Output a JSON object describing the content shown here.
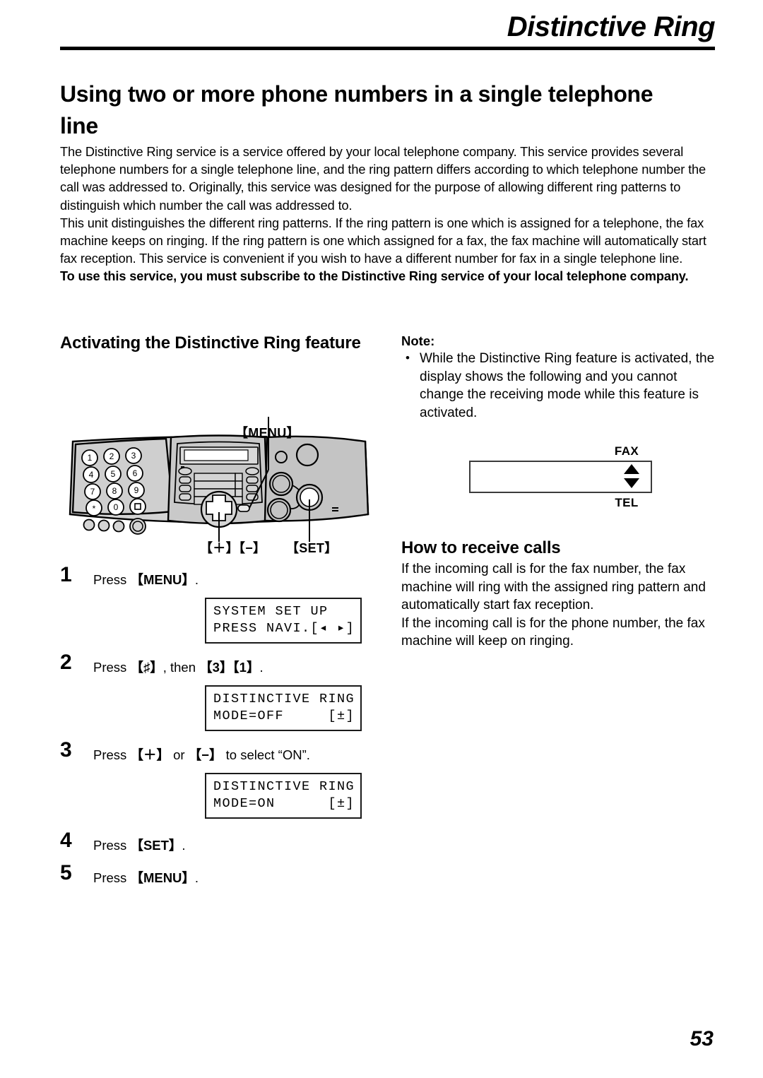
{
  "header": {
    "chapter_title": "Distinctive Ring"
  },
  "page_title": "Using two or more phone numbers in a single telephone line",
  "intro": {
    "paragraph1": "The Distinctive Ring service is a service offered by your local telephone company. This service provides several telephone numbers for a single telephone line, and the ring pattern differs according to which telephone number the call was addressed to. Originally, this service was designed for the purpose of allowing different ring patterns to distinguish which number the call was addressed to.",
    "paragraph2": "This unit distinguishes the different ring patterns. If the ring pattern is one which is assigned for a telephone, the fax machine keeps on ringing. If the ring pattern is one which assigned for a fax, the fax machine will automatically start fax reception. This service is convenient if you wish to have a different number for fax in a single telephone line.",
    "paragraph3_bold": "To use this service, you must subscribe to the Distinctive Ring service of your local telephone company."
  },
  "left_column": {
    "section_heading": "Activating the Distinctive Ring feature",
    "figure": {
      "callout_menu": "【MENU】",
      "callout_plusminus": "【＋】【−】",
      "callout_set": "【SET】",
      "keypad_keys": [
        "1",
        "2",
        "3",
        "4",
        "5",
        "6",
        "7",
        "8",
        "9",
        "∗",
        "0",
        "□"
      ]
    },
    "steps": [
      {
        "number": "1",
        "text_parts": [
          {
            "t": "Press ",
            "b": false
          },
          {
            "t": "【MENU】",
            "b": true
          },
          {
            "t": ".",
            "b": false
          }
        ],
        "lcd": {
          "line1": "SYSTEM SET UP",
          "line2": "PRESS NAVI.[◂ ▸]"
        }
      },
      {
        "number": "2",
        "text_parts": [
          {
            "t": "Press ",
            "b": false
          },
          {
            "t": "【♯】",
            "b": true
          },
          {
            "t": ", then ",
            "b": false
          },
          {
            "t": "【3】【1】",
            "b": true
          },
          {
            "t": ".",
            "b": false
          }
        ],
        "lcd": {
          "line1": "DISTINCTIVE RING",
          "line2": "MODE=OFF     [±]"
        }
      },
      {
        "number": "3",
        "text_parts": [
          {
            "t": "Press ",
            "b": false
          },
          {
            "t": "【＋】",
            "b": true
          },
          {
            "t": " or ",
            "b": false
          },
          {
            "t": "【−】",
            "b": true
          },
          {
            "t": " to select “ON”.",
            "b": false
          }
        ],
        "lcd": {
          "line1": "DISTINCTIVE RING",
          "line2": "MODE=ON      [±]"
        }
      },
      {
        "number": "4",
        "text_parts": [
          {
            "t": "Press ",
            "b": false
          },
          {
            "t": "【SET】",
            "b": true
          },
          {
            "t": ".",
            "b": false
          }
        ],
        "lcd": null
      },
      {
        "number": "5",
        "text_parts": [
          {
            "t": "Press ",
            "b": false
          },
          {
            "t": "【MENU】",
            "b": true
          },
          {
            "t": ".",
            "b": false
          }
        ],
        "lcd": null
      }
    ]
  },
  "right_column": {
    "note_title": "Note:",
    "note_items": [
      "While the Distinctive Ring feature is activated, the display shows the following and you cannot change the receiving mode while this feature is activated."
    ],
    "display_figure": {
      "label_fax": "FAX",
      "label_tel": "TEL",
      "lcd_text": ""
    },
    "receive_heading": "How to receive calls",
    "receive_paragraph1": "If the incoming call is for the fax number, the fax machine will ring with the assigned ring pattern and automatically start fax reception.",
    "receive_paragraph2": "If the incoming call is for the phone number, the fax machine will keep on ringing."
  },
  "footer": {
    "page_number": "53"
  }
}
